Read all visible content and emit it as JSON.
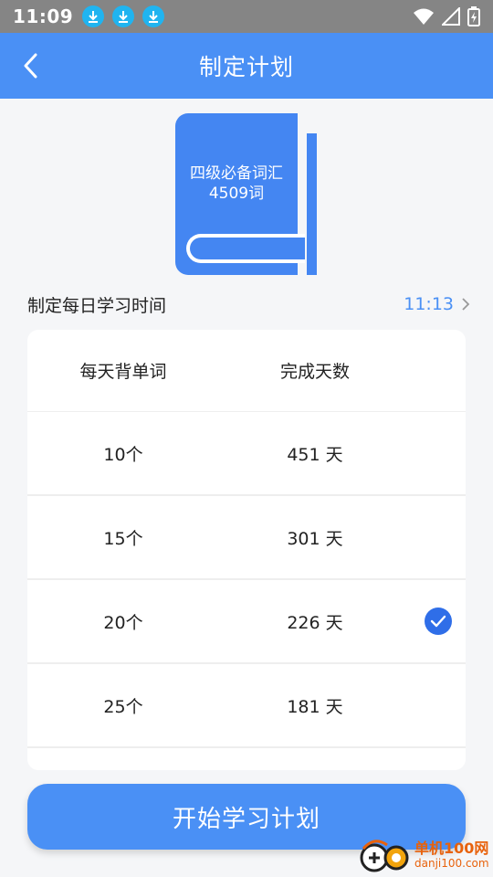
{
  "status_bar": {
    "time": "11:09"
  },
  "app_bar": {
    "title": "制定计划"
  },
  "book": {
    "title_line1": "四级必备词汇",
    "title_line2": "4509词"
  },
  "schedule": {
    "label": "制定每日学习时间",
    "time": "11:13"
  },
  "plan_table": {
    "header_words": "每天背单词",
    "header_days": "完成天数",
    "rows": [
      {
        "words": "10个",
        "days": "451 天",
        "selected": false
      },
      {
        "words": "15个",
        "days": "301 天",
        "selected": false
      },
      {
        "words": "20个",
        "days": "226 天",
        "selected": true
      },
      {
        "words": "25个",
        "days": "181 天",
        "selected": false
      }
    ]
  },
  "start_button_label": "开始学习计划",
  "watermark": {
    "cn": "单机100网",
    "en": "danji100.com"
  },
  "colors": {
    "accent": "#4a90f5",
    "check": "#2f6ee8",
    "status_bar": "#858585"
  }
}
